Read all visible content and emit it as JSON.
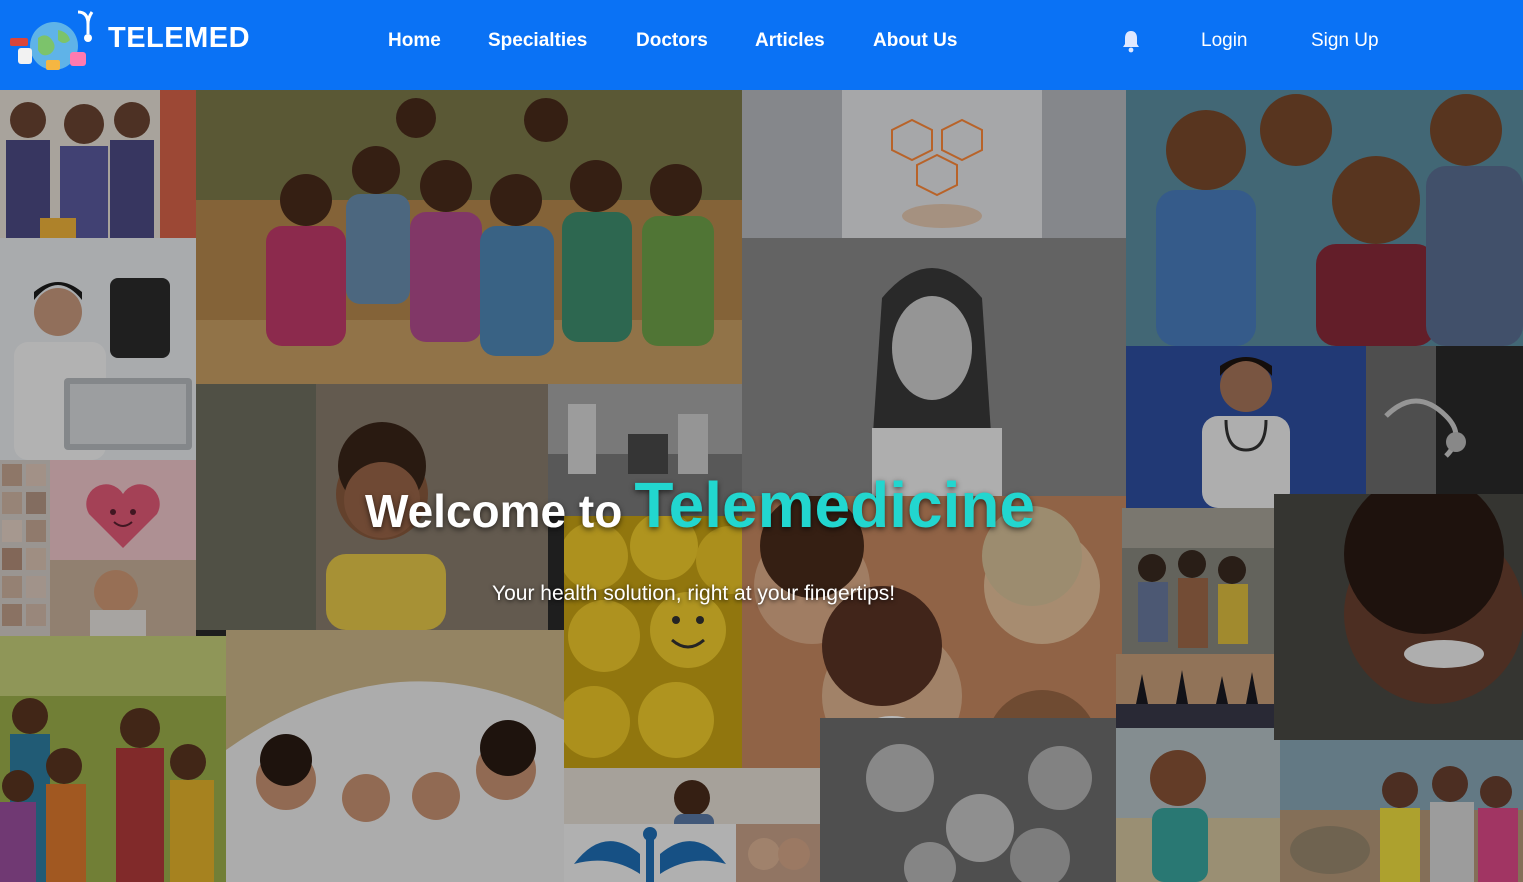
{
  "navbar": {
    "brand": "TELEMED",
    "links": [
      {
        "label": "Home"
      },
      {
        "label": "Specialties"
      },
      {
        "label": "Doctors"
      },
      {
        "label": "Articles"
      },
      {
        "label": "About Us"
      }
    ],
    "login_label": "Login",
    "signup_label": "Sign Up",
    "bg_color": "#0a72f5"
  },
  "hero": {
    "title_prefix": "Welcome to",
    "title_highlight": "Telemedicine",
    "subtitle": "Your health solution, right at your fingertips!",
    "highlight_color": "#22d6cf"
  },
  "icons": {
    "notification": "bell-icon",
    "logo": "globe-stethoscope-logo"
  }
}
